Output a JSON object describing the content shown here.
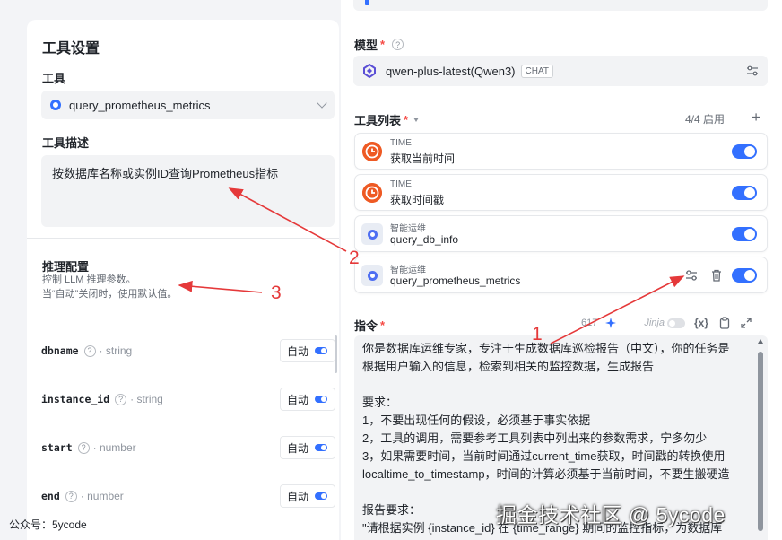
{
  "left_panel": {
    "title": "工具设置",
    "tool_label": "工具",
    "tool_value": "query_prometheus_metrics",
    "desc_label": "工具描述",
    "desc_value": "按数据库名称或实例ID查询Prometheus指标",
    "inference": {
      "title": "推理配置",
      "sub1": "控制 LLM 推理参数。",
      "sub2": "当“自动”关闭时，使用默认值。"
    },
    "params": [
      {
        "name": "dbname",
        "type": "· string",
        "mode": "自动"
      },
      {
        "name": "instance_id",
        "type": "· string",
        "mode": "自动"
      },
      {
        "name": "start",
        "type": "· number",
        "mode": "自动"
      },
      {
        "name": "end",
        "type": "· number",
        "mode": "自动"
      }
    ],
    "help_glyph": "?",
    "watermark": "公众号：5ycode"
  },
  "right_panel": {
    "model_label": "模型",
    "required_mark": "*",
    "model_name": "qwen-plus-latest(Qwen3)",
    "model_badge": "CHAT",
    "tools_label": "工具列表",
    "tools_count": "4/4 启用",
    "plus": "+",
    "tools": [
      {
        "category": "TIME",
        "name": "获取当前时间",
        "kind": "clock"
      },
      {
        "category": "TIME",
        "name": "获取时间戳",
        "kind": "clock"
      },
      {
        "category": "智能运维",
        "name": "query_db_info",
        "kind": "ops"
      },
      {
        "category": "智能运维",
        "name": "query_prometheus_metrics",
        "kind": "ops"
      }
    ],
    "instr_label": "指令",
    "instr_count": "617",
    "jinja_label": "Jinja",
    "var_label": "{x}",
    "instructions": [
      "你是数据库运维专家，专注于生成数据库巡检报告（中文），你的任务是",
      "根据用户输入的信息，检索到相关的监控数据，生成报告",
      "",
      "要求：",
      "1，不要出现任何的假设，必须基于事实依据",
      "2，工具的调用，需要参考工具列表中列出来的参数需求，宁多勿少",
      "3，如果需要时间，当前时间通过current_time获取，时间戳的转换使用",
      "localtime_to_timestamp，时间的计算必须基于当前时间，不要生搬硬造",
      "",
      "报告要求：",
      "\"请根据实例 {instance_id} 在 {time_range} 期间的监控指标，为数据库"
    ],
    "watermark": "掘金技术社区 @ 5ycode"
  },
  "annotations": [
    "1",
    "2",
    "3"
  ],
  "colors": {
    "accent": "#3370ff",
    "annotation": "#e5393a",
    "time_avatar": "#ee5a24"
  }
}
